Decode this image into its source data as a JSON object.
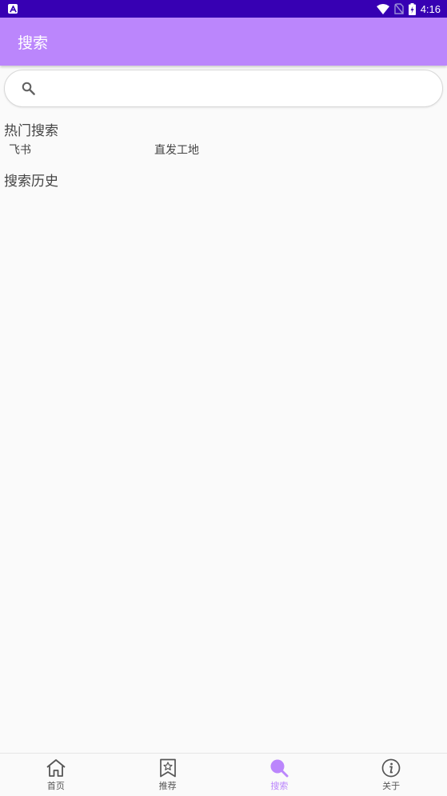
{
  "status_bar": {
    "time": "4:16",
    "notification_icon": "android-a-icon",
    "icons": [
      "wifi-icon",
      "no-sim-icon",
      "battery-charging-icon"
    ]
  },
  "app_bar": {
    "title": "搜索",
    "color": "#bb86fc"
  },
  "search": {
    "value": "",
    "placeholder": ""
  },
  "hot_search": {
    "title": "热门搜索",
    "items": [
      "飞书",
      "直发工地"
    ]
  },
  "history": {
    "title": "搜索历史",
    "items": []
  },
  "bottom_nav": {
    "active_color": "#bb86fc",
    "items": [
      {
        "label": "首页",
        "icon": "home-icon"
      },
      {
        "label": "推荐",
        "icon": "bookmark-star-icon"
      },
      {
        "label": "搜索",
        "icon": "search-icon",
        "active": true
      },
      {
        "label": "关于",
        "icon": "info-icon"
      }
    ]
  }
}
